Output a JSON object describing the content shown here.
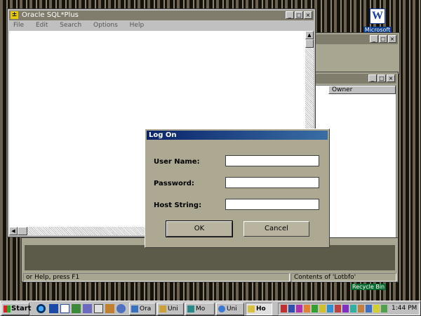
{
  "desktop": {
    "word_icon_label": "Microsoft",
    "recycle_label": "Recycle Bin"
  },
  "sqlplus": {
    "title": "Oracle SQL*Plus",
    "menu": [
      "File",
      "Edit",
      "Search",
      "Options",
      "Help"
    ]
  },
  "bg_window": {
    "column_header": "Owner"
  },
  "statusbar": {
    "left_text": "or Help, press F1",
    "right_text": "Contents of 'Lotbfo'"
  },
  "dialog": {
    "title": "Log On",
    "user_label": "User Name:",
    "password_label": "Password:",
    "host_label": "Host String:",
    "user_value": "",
    "password_value": "",
    "host_value": "",
    "ok_label": "OK",
    "cancel_label": "Cancel"
  },
  "taskbar": {
    "start_label": "Start",
    "tasks": [
      "Ora",
      "Uni",
      "Mo",
      "Uni",
      "Ho"
    ],
    "clock": "1:44 PM"
  }
}
